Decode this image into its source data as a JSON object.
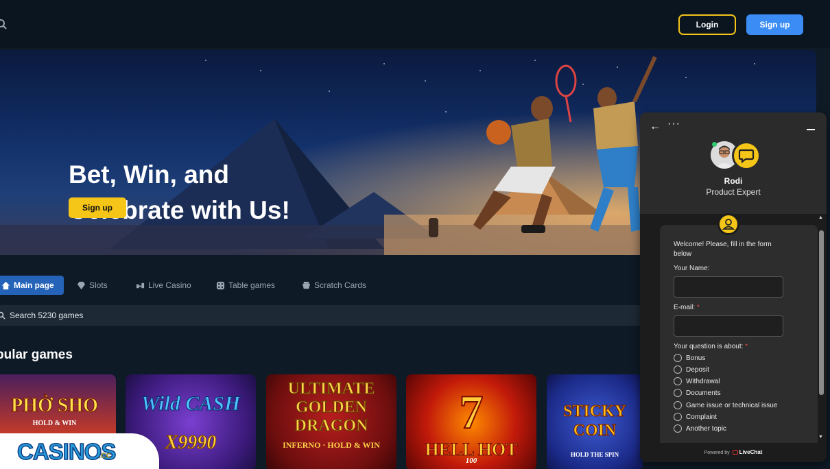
{
  "header": {
    "login_label": "Login",
    "signup_label": "Sign up"
  },
  "hero": {
    "title": "Bet, Win, and Celebrate with Us!",
    "cta_label": "Sign up"
  },
  "tabs": [
    {
      "label": "Main page",
      "icon": "home-icon",
      "active": true
    },
    {
      "label": "Slots",
      "icon": "diamond-icon",
      "active": false
    },
    {
      "label": "Live Casino",
      "icon": "live-casino-icon",
      "active": false
    },
    {
      "label": "Table games",
      "icon": "dice-icon",
      "active": false
    },
    {
      "label": "Scratch Cards",
      "icon": "scratch-card-icon",
      "active": false
    }
  ],
  "search": {
    "placeholder": "Search 5230 games"
  },
  "section": {
    "title": "pular games"
  },
  "games": [
    {
      "title": "PHỞ SHO",
      "subtitle": "HOLD & WIN"
    },
    {
      "title": "Wild CASH",
      "subtitle": "X9990"
    },
    {
      "title": "ULTIMATE GOLDEN DRAGON",
      "subtitle": "INFERNO · HOLD & WIN"
    },
    {
      "title": "HELL HOT",
      "subtitle": "100"
    },
    {
      "title": "STICKY COIN",
      "subtitle": "HOLD THE SPIN"
    }
  ],
  "logo": {
    "text": "CASINOS",
    "suffix": ".cc"
  },
  "chat": {
    "agent_name": "Rodi",
    "agent_role": "Product Expert",
    "welcome": "Welcome! Please, fill in the form below",
    "name_label": "Your Name:",
    "email_label": "E-mail:",
    "question_label": "Your question is about:",
    "required_mark": "*",
    "topics": [
      "Bonus",
      "Deposit",
      "Withdrawal",
      "Documents",
      "Game issue or technical issue",
      "Complaint",
      "Another topic"
    ],
    "powered_by": "Powered by",
    "brand": "LiveChat"
  },
  "colors": {
    "accent_yellow": "#f5c518",
    "accent_blue": "#3b8cf5",
    "background": "#0e1a26"
  }
}
